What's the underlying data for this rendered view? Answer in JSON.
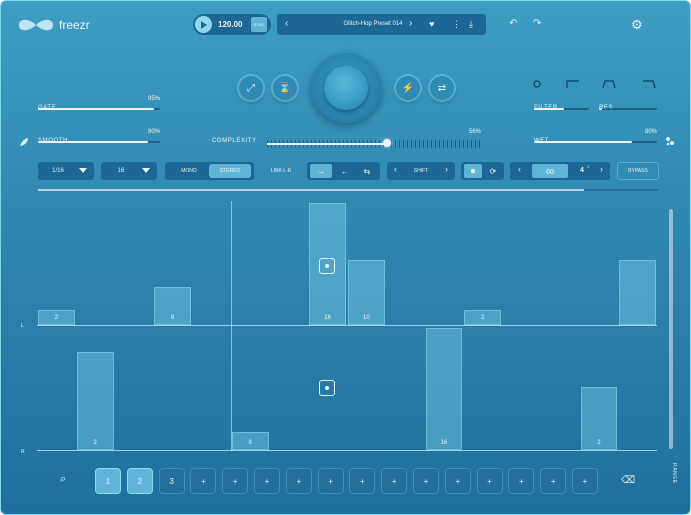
{
  "header": {
    "logo_text": "freezr",
    "bpm": "120.00",
    "sync_label": "SYNC",
    "preset_name": "Glitch-Hop Preset 014",
    "prev": "‹",
    "next": "›",
    "heart": "♥",
    "more": "⋮",
    "download": "⤓",
    "undo": "↶",
    "redo": "↷",
    "settings": "⚙"
  },
  "knobs_left": [
    {
      "label": "GATE",
      "value": "95%",
      "fraction": 0.95
    },
    {
      "label": "SMOOTH",
      "value": "90%",
      "fraction": 0.9
    }
  ],
  "complexity": {
    "label": "COMPLEXITY",
    "value": "56%",
    "fraction": 0.56
  },
  "knobs_right": [
    {
      "label": "FILTER",
      "fraction": 0.55
    },
    {
      "label": "RES",
      "fraction": 0.02
    },
    {
      "label": "WET",
      "value": "80%",
      "fraction": 0.8
    }
  ],
  "toolbar": {
    "division": "1/16",
    "steps": "16",
    "mono": "MONO",
    "stereo": "STEREO",
    "link": "LINK L-R",
    "shift": "SHIFT",
    "counter": "4",
    "counter_sup": "1",
    "bypass": "BYPASS",
    "infinity": "∞"
  },
  "progress": 0.88,
  "channels": {
    "left": "L",
    "right": "R"
  },
  "lane_top": [
    {
      "col": 0,
      "value": "2",
      "level": 0.12
    },
    {
      "col": 3,
      "value": "8",
      "level": 0.31
    },
    {
      "col": 7,
      "value": "16",
      "level": 1.0
    },
    {
      "col": 8,
      "value": "10",
      "level": 0.53
    },
    {
      "col": 11,
      "value": "2",
      "level": 0.12
    },
    {
      "col": 15,
      "value": "",
      "level": 0.53
    }
  ],
  "lane_bottom": [
    {
      "col": 1,
      "value": "2",
      "level": 0.8
    },
    {
      "col": 5,
      "value": "8",
      "level": 0.15
    },
    {
      "col": 10,
      "value": "16",
      "level": 1.0
    },
    {
      "col": 14,
      "value": "2",
      "level": 0.52
    }
  ],
  "pads": [
    "1",
    "2",
    "3",
    "+",
    "+",
    "+",
    "+",
    "+",
    "+",
    "+",
    "+",
    "+",
    "+",
    "+",
    "+",
    "+"
  ],
  "range_label": "RANGE",
  "footer": {
    "search": "⌕",
    "delete": "⌫"
  }
}
